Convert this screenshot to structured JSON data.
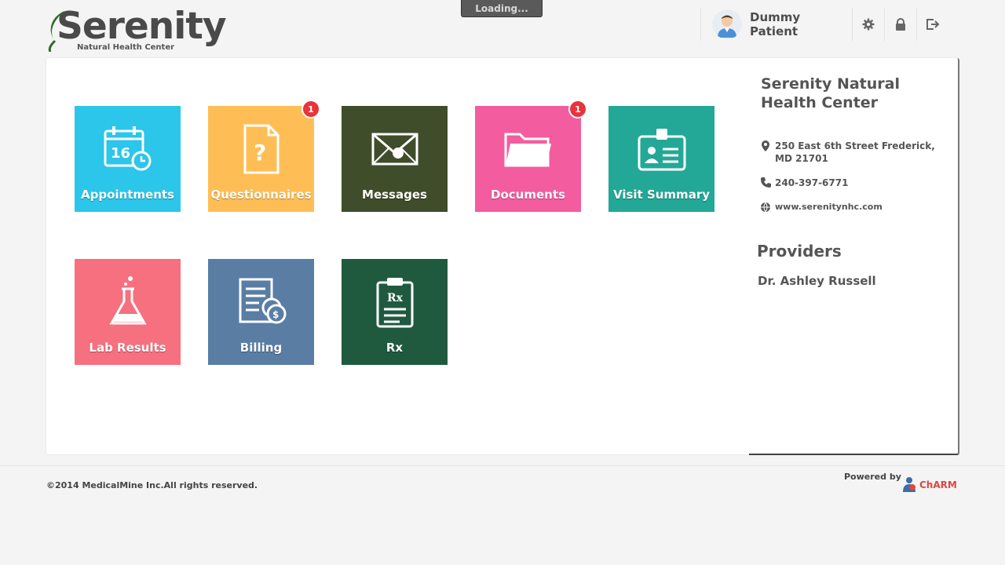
{
  "loading_text": "Loading...",
  "brand": {
    "logo_word": "Serenity",
    "logo_tagline": "Natural Health Center"
  },
  "user": {
    "name": "Dummy Patient",
    "icons": [
      "gear-icon",
      "lock-icon",
      "logout-icon"
    ]
  },
  "tiles": [
    {
      "label": "Appointments",
      "color": "#2bc6ea",
      "icon": "calendar-icon",
      "icon_text": "16",
      "badge": ""
    },
    {
      "label": "Questionnaires",
      "color": "#ffbe55",
      "icon": "question-document-icon",
      "badge": "1"
    },
    {
      "label": "Messages",
      "color": "#3f4d2a",
      "icon": "envelope-icon",
      "badge": ""
    },
    {
      "label": "Documents",
      "color": "#f35d9f",
      "icon": "folder-icon",
      "badge": "1"
    },
    {
      "label": "Visit Summary",
      "color": "#23a897",
      "icon": "id-badge-icon",
      "badge": ""
    },
    {
      "label": "Lab Results",
      "color": "#f6707f",
      "icon": "flask-icon",
      "badge": ""
    },
    {
      "label": "Billing",
      "color": "#5a7da4",
      "icon": "bill-icon",
      "badge": ""
    },
    {
      "label": "Rx",
      "color": "#1f5a3f",
      "icon": "prescription-icon",
      "icon_text": "Rx",
      "badge": ""
    }
  ],
  "clinic": {
    "name": "Serenity Natural Health Center",
    "address": "250 East 6th Street Frederick, MD 21701",
    "phone": "240-397-6771",
    "website": "www.serenitynhc.com"
  },
  "providers": {
    "heading": "Providers",
    "list": [
      "Dr. Ashley Russell"
    ]
  },
  "footer": {
    "copyright": "©2014 MedicalMine Inc.All rights reserved.",
    "powered_by": "Powered by",
    "charm_logo": "ChARM"
  },
  "colors": {
    "badge": "#e8343c",
    "panel": "#ffffff",
    "background": "#f4f4f4"
  }
}
